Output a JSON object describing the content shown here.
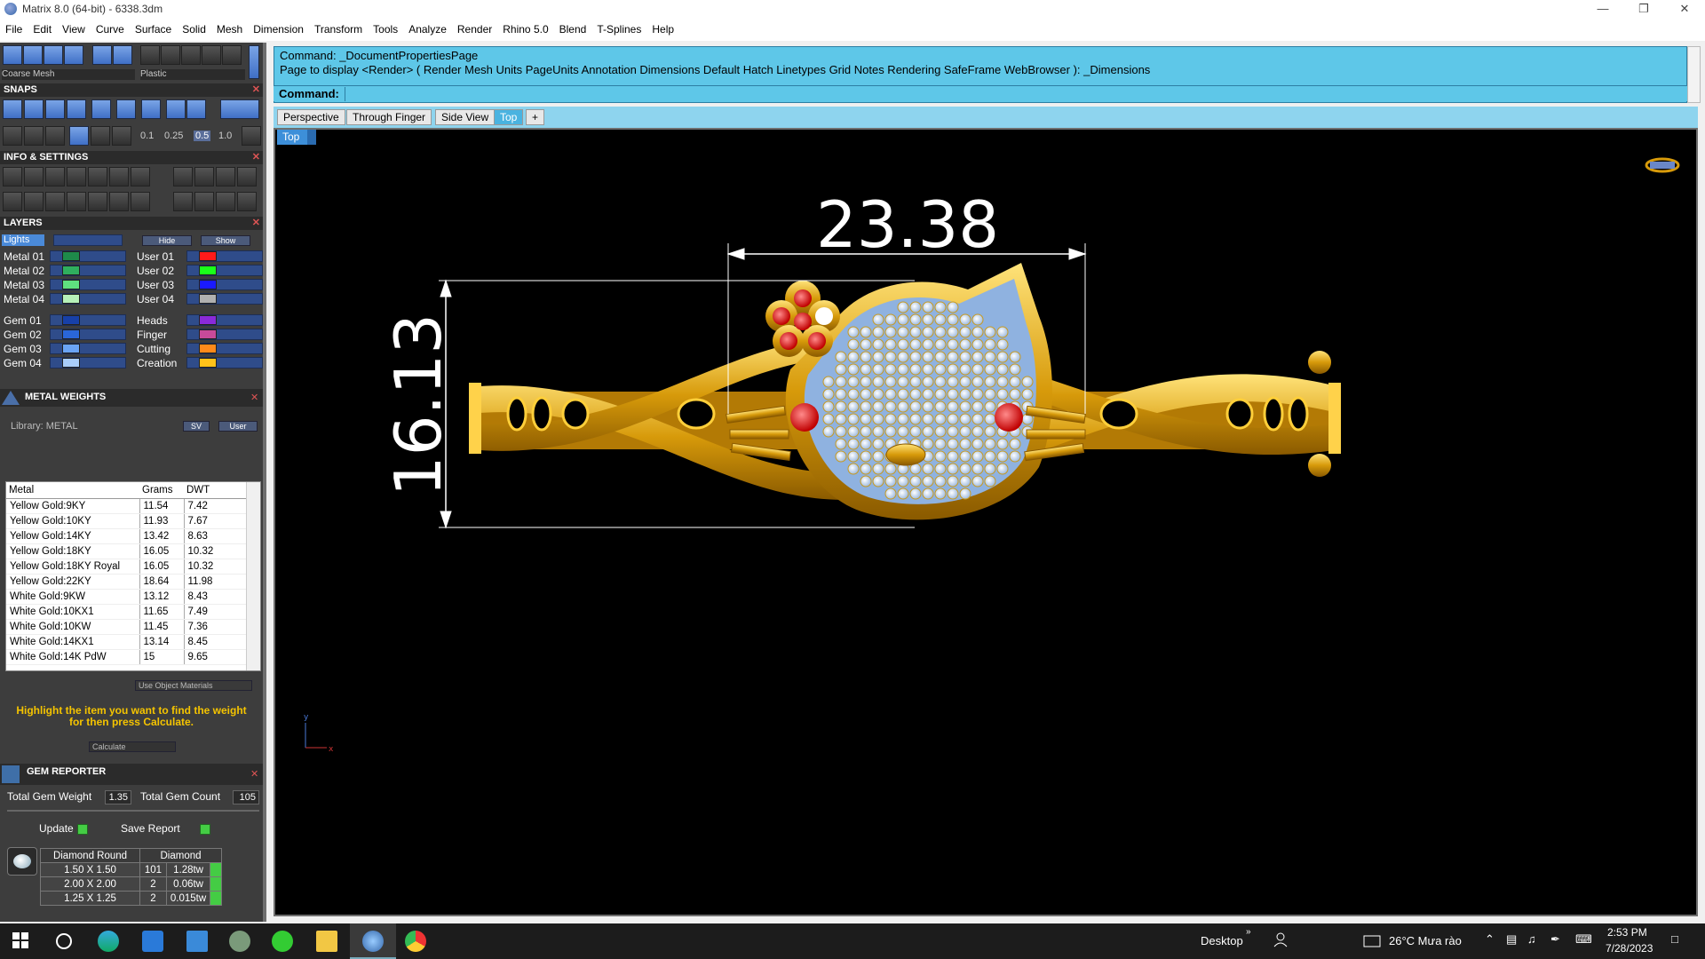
{
  "window": {
    "title": "Matrix 8.0 (64-bit) - 6338.3dm"
  },
  "menu": [
    "File",
    "Edit",
    "View",
    "Curve",
    "Surface",
    "Solid",
    "Mesh",
    "Dimension",
    "Transform",
    "Tools",
    "Analyze",
    "Render",
    "Rhino 5.0",
    "Blend",
    "T-Splines",
    "Help"
  ],
  "toolbar": {
    "mesh_select": "Coarse Mesh",
    "material_select": "Plastic"
  },
  "snaps": {
    "header": "SNAPS",
    "values": [
      "0.1",
      "0.25",
      "0.5",
      "1.0"
    ]
  },
  "info_settings": {
    "header": "INFO & SETTINGS"
  },
  "layers": {
    "header": "LAYERS",
    "lights_label": "Lights",
    "hide_label": "Hide",
    "show_label": "Show",
    "left": [
      {
        "name": "Metal 01",
        "color": "#1e8a4a"
      },
      {
        "name": "Metal 02",
        "color": "#2fae5e"
      },
      {
        "name": "Metal 03",
        "color": "#5fe07f"
      },
      {
        "name": "Metal 04",
        "color": "#b6f0b8"
      },
      {
        "name": "Gem 01",
        "color": "#1740a8"
      },
      {
        "name": "Gem 02",
        "color": "#2a66d9"
      },
      {
        "name": "Gem 03",
        "color": "#6aa4f5"
      },
      {
        "name": "Gem 04",
        "color": "#a9cdfa"
      }
    ],
    "right": [
      {
        "name": "User 01",
        "color": "#ff1a1a"
      },
      {
        "name": "User 02",
        "color": "#1aff1a"
      },
      {
        "name": "User 03",
        "color": "#1a1aff"
      },
      {
        "name": "User 04",
        "color": "#b0b0b0"
      },
      {
        "name": "Heads",
        "color": "#8a2ad9"
      },
      {
        "name": "Finger",
        "color": "#c84a9a"
      },
      {
        "name": "Cutting",
        "color": "#ff8a1a"
      },
      {
        "name": "Creation",
        "color": "#ffc21a"
      }
    ]
  },
  "metal_weights": {
    "header": "METAL WEIGHTS",
    "library": "Library: METAL",
    "btn_sv": "SV",
    "btn_user": "User",
    "columns": [
      "Metal",
      "Grams",
      "DWT"
    ],
    "rows": [
      [
        "Yellow Gold:9KY",
        "11.54",
        "7.42"
      ],
      [
        "Yellow Gold:10KY",
        "11.93",
        "7.67"
      ],
      [
        "Yellow Gold:14KY",
        "13.42",
        "8.63"
      ],
      [
        "Yellow Gold:18KY",
        "16.05",
        "10.32"
      ],
      [
        "Yellow Gold:18KY Royal",
        "16.05",
        "10.32"
      ],
      [
        "Yellow Gold:22KY",
        "18.64",
        "11.98"
      ],
      [
        "White Gold:9KW",
        "13.12",
        "8.43"
      ],
      [
        "White Gold:10KX1",
        "11.65",
        "7.49"
      ],
      [
        "White Gold:10KW",
        "11.45",
        "7.36"
      ],
      [
        "White Gold:14KX1",
        "13.14",
        "8.45"
      ],
      [
        "White Gold:14K PdW",
        "15",
        "9.65"
      ]
    ],
    "use_object_materials": "Use Object Materials",
    "hint_line1": "Highlight the item you want to find the weight",
    "hint_line2": "for then press Calculate.",
    "calculate": "Calculate"
  },
  "gem_reporter": {
    "header": "GEM REPORTER",
    "total_weight_label": "Total Gem Weight",
    "total_weight": "1.35",
    "total_count_label": "Total Gem Count",
    "total_count": "105",
    "update": "Update",
    "save_report": "Save Report",
    "table_head": [
      "Diamond Round",
      "Diamond"
    ],
    "rows": [
      [
        "1.50 X 1.50",
        "101",
        "1.28tw"
      ],
      [
        "2.00 X 2.00",
        "2",
        "0.06tw"
      ],
      [
        "1.25 X 1.25",
        "2",
        "0.015tw"
      ]
    ]
  },
  "command": {
    "line1": "Command: _DocumentPropertiesPage",
    "line2": "Page to display <Render> ( Render  Mesh  Units  PageUnits  Annotation  Dimensions  Default  Hatch  Linetypes  Grid  Notes  Rendering  SafeFrame  WebBrowser ): _Dimensions",
    "prompt": "Command:"
  },
  "tabs": [
    "Perspective",
    "Through Finger",
    "Side View",
    "Top",
    "+"
  ],
  "active_tab": "Top",
  "viewport": {
    "label": "Top",
    "dim_width": "23.38",
    "dim_height": "16.13",
    "axis_y": "y",
    "axis_x": "x"
  },
  "taskbar": {
    "desktop": "Desktop",
    "weather": "26°C  Mưa rào",
    "time": "2:53 PM",
    "date": "7/28/2023"
  }
}
